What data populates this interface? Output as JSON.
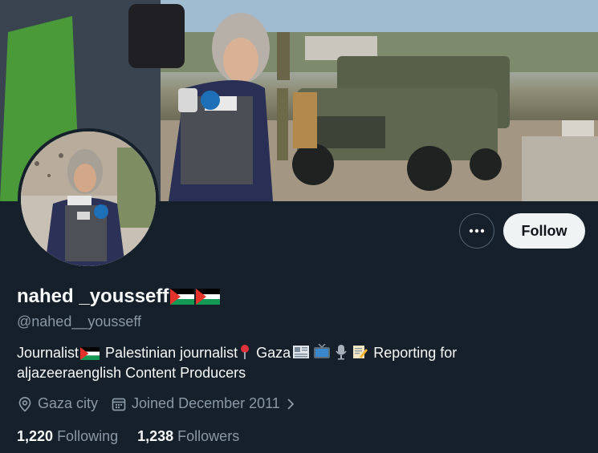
{
  "profile": {
    "display_name": "nahed _yousseff",
    "handle": "@nahed__yousseff",
    "bio": {
      "part1": "Journalist",
      "part2": " Palestinian journalist",
      "part3": " Gaza",
      "part4": " Reporting for aljazeeraenglish Content Producers"
    },
    "location": "Gaza city",
    "joined": "Joined December 2011",
    "following_count": "1,220",
    "following_label": "Following",
    "followers_count": "1,238",
    "followers_label": "Followers"
  },
  "actions": {
    "follow_label": "Follow"
  },
  "icons": {
    "more": "more-dots-icon",
    "location": "location-pin-icon",
    "calendar": "calendar-icon",
    "chevron": "chevron-right-icon",
    "flag": "palestine-flag-icon",
    "pin": "red-pin-icon",
    "newspaper": "newspaper-icon",
    "tv": "television-icon",
    "mic": "microphone-icon",
    "memo": "memo-icon"
  },
  "colors": {
    "background": "#15202b",
    "text_primary": "#f7f9f9",
    "text_secondary": "#8b98a5",
    "follow_bg": "#eff3f4"
  }
}
